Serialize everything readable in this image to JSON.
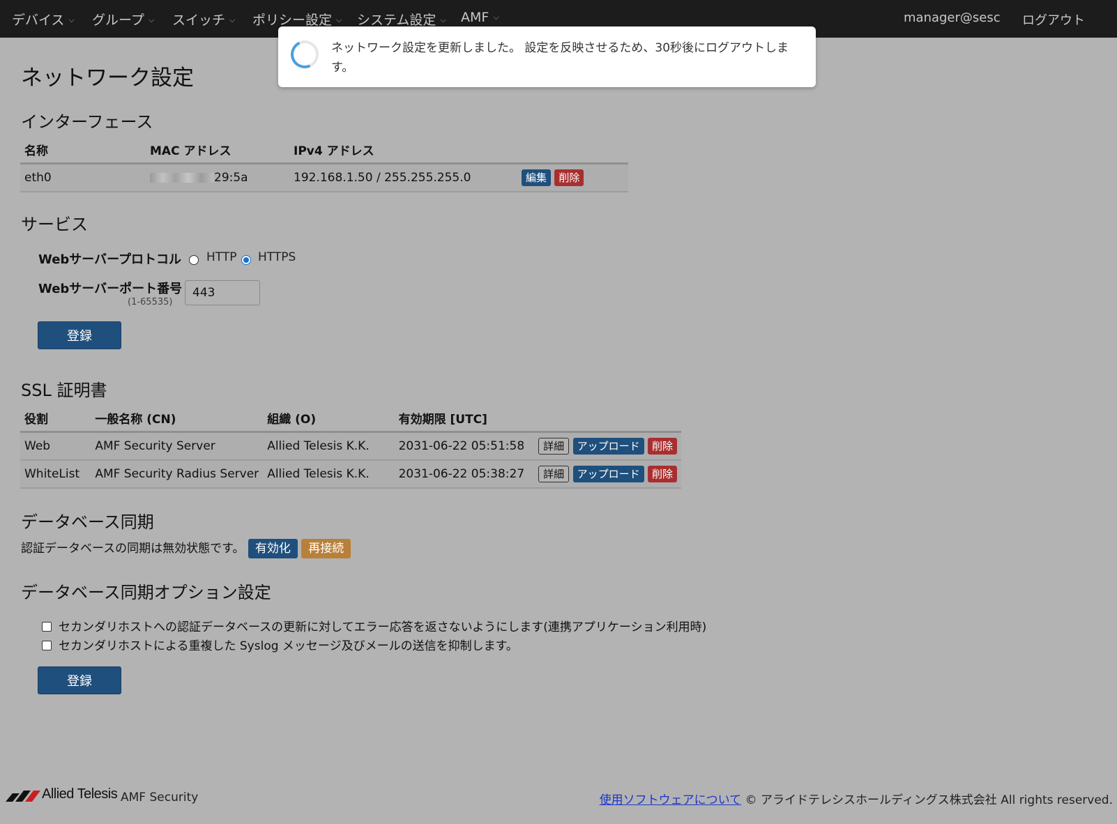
{
  "nav": {
    "menus": [
      "デバイス",
      "グループ",
      "スイッチ",
      "ポリシー設定",
      "システム設定",
      "AMF"
    ],
    "user": "manager@sesc",
    "logout": "ログアウト"
  },
  "toast": {
    "message": "ネットワーク設定を更新しました。 設定を反映させるため、30秒後にログアウトします。"
  },
  "page": {
    "title": "ネットワーク設定"
  },
  "interface": {
    "title": "インターフェース",
    "headers": [
      "名称",
      "MAC アドレス",
      "IPv4 アドレス"
    ],
    "rows": [
      {
        "name": "eth0",
        "mac_suffix": "29:5a",
        "ipv4": "192.168.1.50 / 255.255.255.0",
        "edit": "編集",
        "delete": "削除"
      }
    ]
  },
  "service": {
    "title": "サービス",
    "protocol_label": "Webサーバープロトコル",
    "protocol_options": [
      "HTTP",
      "HTTPS"
    ],
    "protocol_selected": "HTTPS",
    "port_label": "Webサーバーポート番号",
    "port_range": "(1-65535)",
    "port_value": "443",
    "submit": "登録"
  },
  "ssl": {
    "title": "SSL 証明書",
    "headers": [
      "役割",
      "一般名称 (CN)",
      "組織 (O)",
      "有効期限 [UTC]"
    ],
    "rows": [
      {
        "role": "Web",
        "cn": "AMF Security Server",
        "org": "Allied Telesis K.K.",
        "expires": "2031-06-22 05:51:58",
        "detail": "詳細",
        "upload": "アップロード",
        "delete": "削除"
      },
      {
        "role": "WhiteList",
        "cn": "AMF Security Radius Server",
        "org": "Allied Telesis K.K.",
        "expires": "2031-06-22 05:38:27",
        "detail": "詳細",
        "upload": "アップロード",
        "delete": "削除"
      }
    ]
  },
  "db_sync": {
    "title": "データベース同期",
    "status": "認証データベースの同期は無効状態です。",
    "enable": "有効化",
    "reconnect": "再接続"
  },
  "db_sync_options": {
    "title": "データベース同期オプション設定",
    "options": [
      {
        "label": "セカンダリホストへの認証データベースの更新に対してエラー応答を返さないようにします(連携アプリケーション利用時)",
        "checked": false
      },
      {
        "label": "セカンダリホストによる重複した Syslog メッセージ及びメールの送信を抑制します。",
        "checked": false
      }
    ],
    "submit": "登録"
  },
  "footer": {
    "brand": "Allied Telesis",
    "product": "AMF Security",
    "link": "使用ソフトウェアについて",
    "copyright": "© アライドテレシスホールディングス株式会社 All rights reserved."
  },
  "colors": {
    "navbar": "#1c1c1c",
    "overlay_bg": "#b3b3b3",
    "primary": "#1f4f7c",
    "danger": "#a82f2f",
    "warning": "#b9803a",
    "spinner": "#4a9fe0"
  }
}
